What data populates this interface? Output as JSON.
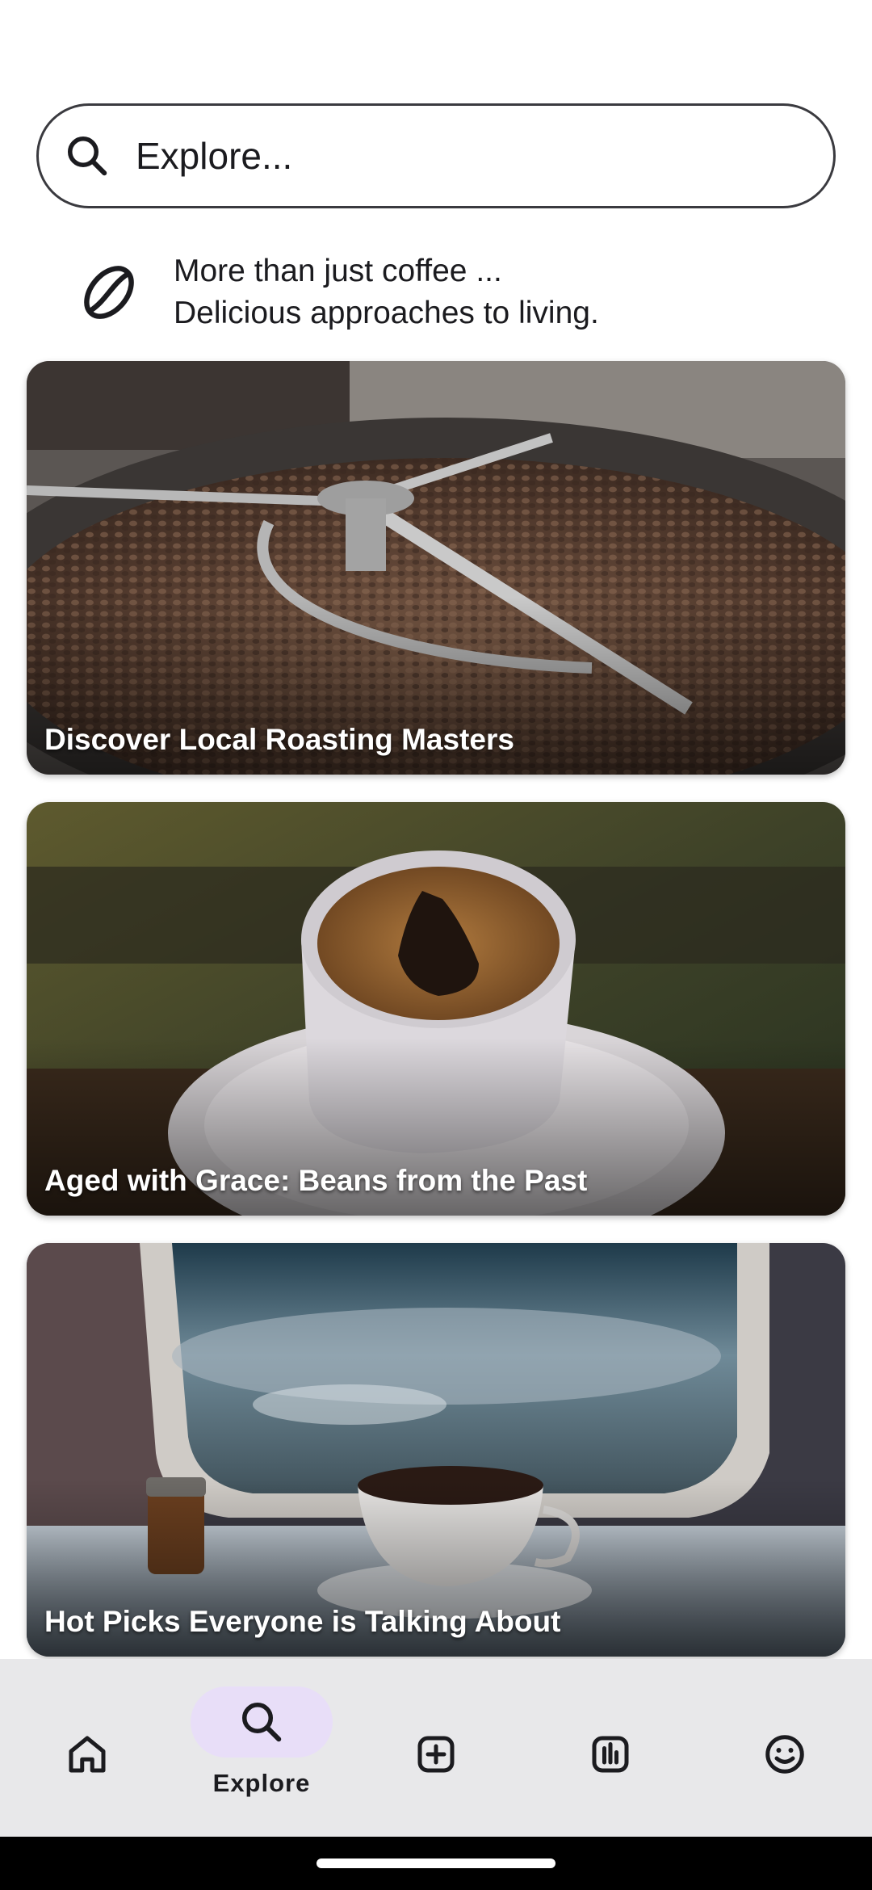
{
  "search": {
    "placeholder": "Explore..."
  },
  "tagline": {
    "line1": "More than just coffee ...",
    "line2": "Delicious approaches to living."
  },
  "cards": [
    {
      "title": "Discover Local Roasting Masters",
      "image": "coffee-roaster-drum"
    },
    {
      "title": "Aged with Grace: Beans from the Past",
      "image": "espresso-cup-on-saucer"
    },
    {
      "title": "Hot Picks Everyone is Talking About",
      "image": "coffee-cup-airplane-window"
    }
  ],
  "nav": {
    "active": "Explore",
    "items": [
      {
        "icon": "home-icon"
      },
      {
        "icon": "search-icon",
        "label": "Explore"
      },
      {
        "icon": "add-box-icon"
      },
      {
        "icon": "insights-icon"
      },
      {
        "icon": "smiley-icon"
      }
    ]
  },
  "colors": {
    "active_pill": "#e8def8",
    "nav_background": "#e8e8ea",
    "text": "#1b1b1f"
  }
}
